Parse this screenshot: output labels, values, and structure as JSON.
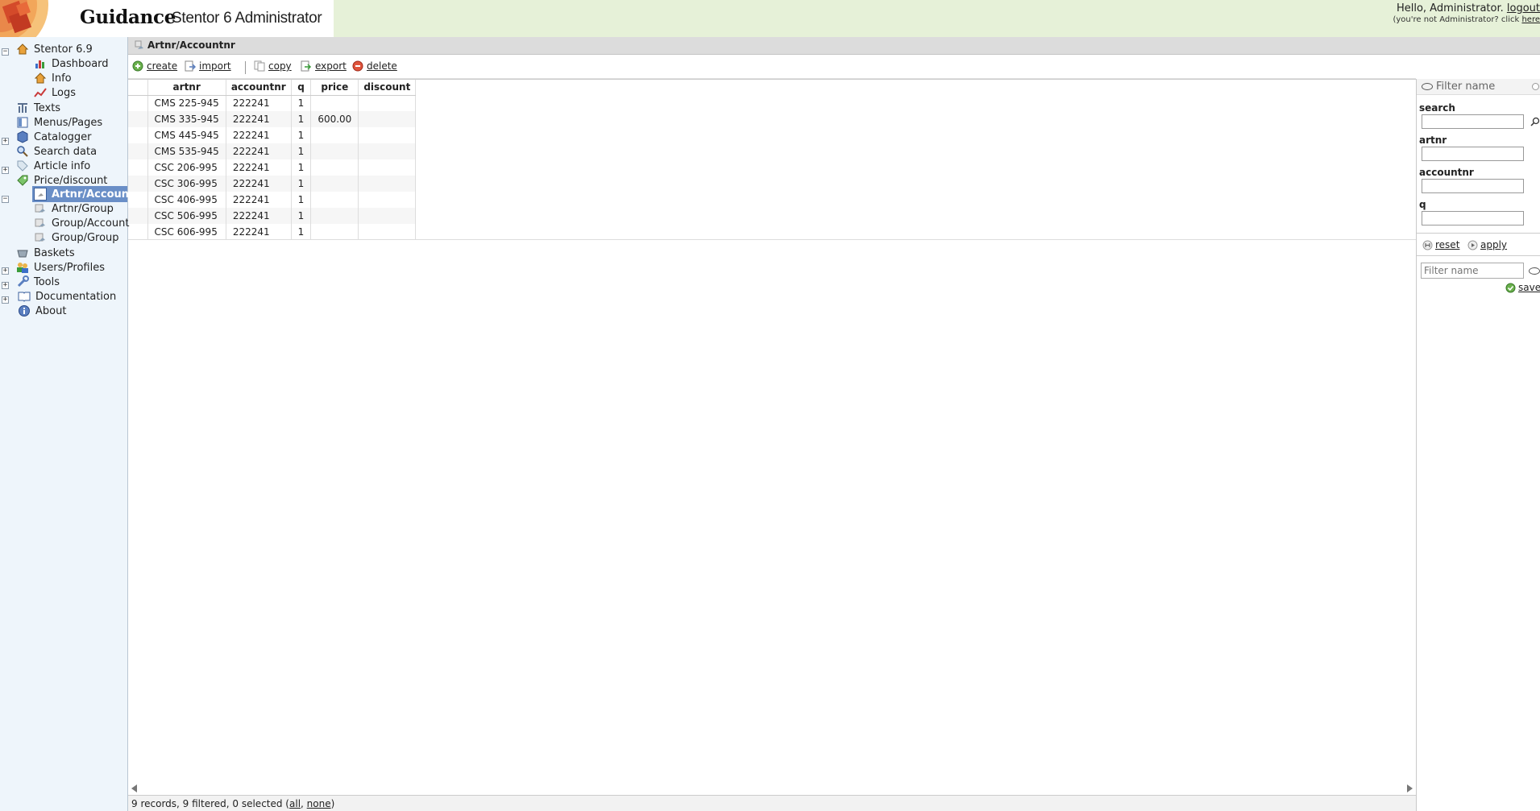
{
  "header": {
    "brand": "Guidance",
    "product": "Stentor 6 Administrator",
    "hello": "Hello, Administrator.",
    "logout": "logout",
    "not_admin": "(you're not Administrator? click",
    "here": "here"
  },
  "sidebar": {
    "items": [
      {
        "label": "Stentor 6.9",
        "icon": "home-icon"
      },
      {
        "label": "Dashboard",
        "icon": "chart-icon"
      },
      {
        "label": "Info",
        "icon": "home-icon"
      },
      {
        "label": "Logs",
        "icon": "line-chart-icon"
      },
      {
        "label": "Texts",
        "icon": "text-icon"
      },
      {
        "label": "Menus/Pages",
        "icon": "page-icon"
      },
      {
        "label": "Catalogger",
        "icon": "cube-icon"
      },
      {
        "label": "Search data",
        "icon": "magnifier-icon"
      },
      {
        "label": "Article info",
        "icon": "tag-icon"
      },
      {
        "label": "Price/discount",
        "icon": "price-tag-icon"
      },
      {
        "label": "Artnr/Account",
        "icon": "price-icon"
      },
      {
        "label": "Artnr/Group",
        "icon": "price-icon"
      },
      {
        "label": "Group/Account",
        "icon": "price-icon"
      },
      {
        "label": "Group/Group",
        "icon": "price-icon"
      },
      {
        "label": "Baskets",
        "icon": "basket-icon"
      },
      {
        "label": "Users/Profiles",
        "icon": "users-icon"
      },
      {
        "label": "Tools",
        "icon": "wrench-icon"
      },
      {
        "label": "Documentation",
        "icon": "book-icon"
      },
      {
        "label": "About",
        "icon": "info-icon"
      }
    ],
    "expanders": [
      "−",
      "+",
      "+",
      "−",
      "+",
      "+",
      "+"
    ]
  },
  "main": {
    "breadcrumb": "Artnr/Accountnr",
    "toolbar": {
      "create": "create",
      "import": "import",
      "copy": "copy",
      "export": "export",
      "delete": "delete"
    },
    "table": {
      "columns": [
        "artnr",
        "accountnr",
        "q",
        "price",
        "discount"
      ],
      "rows": [
        [
          "CMS 225-945",
          "222241",
          "1",
          "",
          ""
        ],
        [
          "CMS 335-945",
          "222241",
          "1",
          "600.00",
          ""
        ],
        [
          "CMS 445-945",
          "222241",
          "1",
          "",
          ""
        ],
        [
          "CMS 535-945",
          "222241",
          "1",
          "",
          ""
        ],
        [
          "CSC 206-995",
          "222241",
          "1",
          "",
          ""
        ],
        [
          "CSC 306-995",
          "222241",
          "1",
          "",
          ""
        ],
        [
          "CSC 406-995",
          "222241",
          "1",
          "",
          ""
        ],
        [
          "CSC 506-995",
          "222241",
          "1",
          "",
          ""
        ],
        [
          "CSC 606-995",
          "222241",
          "1",
          "",
          ""
        ]
      ]
    },
    "status": {
      "text": "9 records, 9 filtered, 0 selected (",
      "all": "all",
      "sep": ", ",
      "none": "none",
      "end": ")"
    }
  },
  "filter": {
    "title": "Filter name",
    "search_label": "search",
    "artnr_label": "artnr",
    "accountnr_label": "accountnr",
    "q_label": "q",
    "reset": "reset",
    "apply": "apply",
    "name_placeholder": "Filter name",
    "save": "save"
  },
  "colors": {
    "header_green": "#e6f1d8",
    "sidebar_bg": "#eef5fb",
    "selected": "#6a8fc7"
  }
}
